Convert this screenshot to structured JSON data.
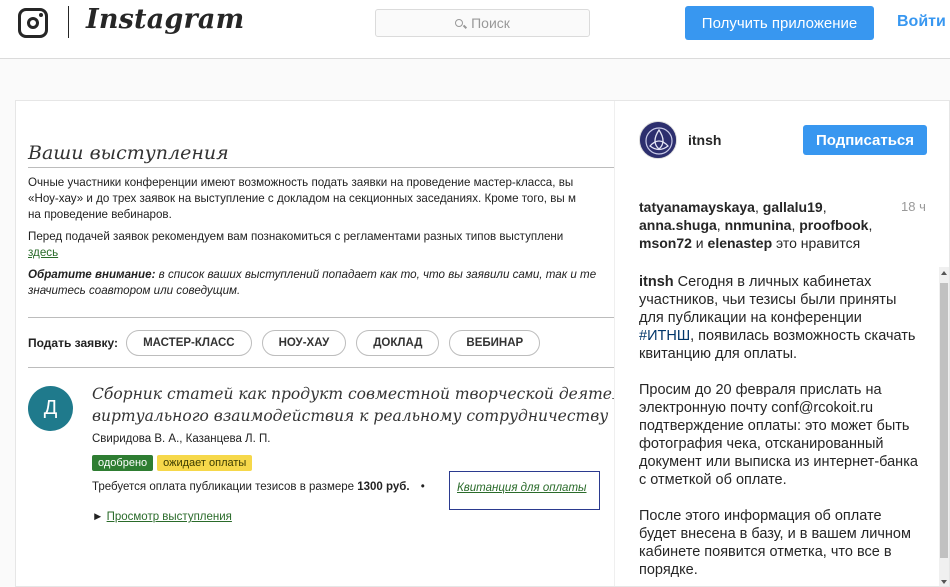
{
  "topbar": {
    "wordmark": "Instagram",
    "search_placeholder": "Поиск",
    "get_app_label": "Получить приложение",
    "login_label": "Войти"
  },
  "post_image": {
    "title": "Ваши выступления",
    "para1_line1": "Очные участники конференции имеют возможность подать заявки на проведение мастер-класса, вы",
    "para1_line2": "«Ноу-хау» и до трех заявок на выступление с докладом на секционных заседаниях. Кроме того, вы м",
    "para1_line3": "на проведение вебинаров.",
    "para2_line1": "Перед подачей заявок рекомендуем вам познакомиться с регламентами разных типов выступлени",
    "para2_link": "здесь",
    "para3_bold": "Обратите внимание:",
    "para3_line1_rest": " в список ваших выступлений попадает как то, что вы заявили сами, так и те",
    "para3_line2": "значитесь соавтором или соведущим.",
    "apply_label": "Подать заявку:",
    "buttons": [
      "МАСТЕР-КЛАСС",
      "НОУ-ХАУ",
      "ДОКЛАД",
      "ВЕБИНАР"
    ],
    "avatar_letter": "Д",
    "article_title_line1": "Сборник статей как продукт совместной творческой деятельност",
    "article_title_line2": "виртуального взаимодействия к реальному сотрудничеству",
    "authors": "Свиридова В. А., Казанцева Л. П.",
    "badge_approved": "одобрено",
    "badge_waiting": "ожидает оплаты",
    "payment_text": "Требуется оплата публикации тезисов в размере ",
    "payment_amount": "1300 руб.",
    "bullet": "•",
    "receipt_link": "Квитанция для оплаты",
    "view_arrow": "►",
    "view_link": "Просмотр выступления"
  },
  "side": {
    "username": "itnsh",
    "follow_label": "Подписаться",
    "likers": [
      "tatyanamayskaya",
      "gallalu19",
      "anna.shuga",
      "nnmunina",
      "proofbook",
      "mson72",
      "elenastep"
    ],
    "likes_and": " и ",
    "likes_suffix": " это нравится",
    "time": "18 ч",
    "caption_user": "itnsh",
    "caption_p1_a": " Сегодня в личных кабинетах участников, чьи тезисы были приняты для публикации на конференции ",
    "caption_tag": "#ИТНШ",
    "caption_p1_b": ", появилась возможность скачать квитанцию для оплаты.",
    "caption_p2": "Просим до 20 февраля прислать на электронную почту conf@rcokoit.ru подтверждение оплаты: это может быть фотография чека, отсканированный документ или выписка из интернет-банка с отметкой об оплате.",
    "caption_p3": "После этого информация об оплате будет внесена в базу, и в вашем личном кабинете появится отметка, что все в порядке."
  }
}
